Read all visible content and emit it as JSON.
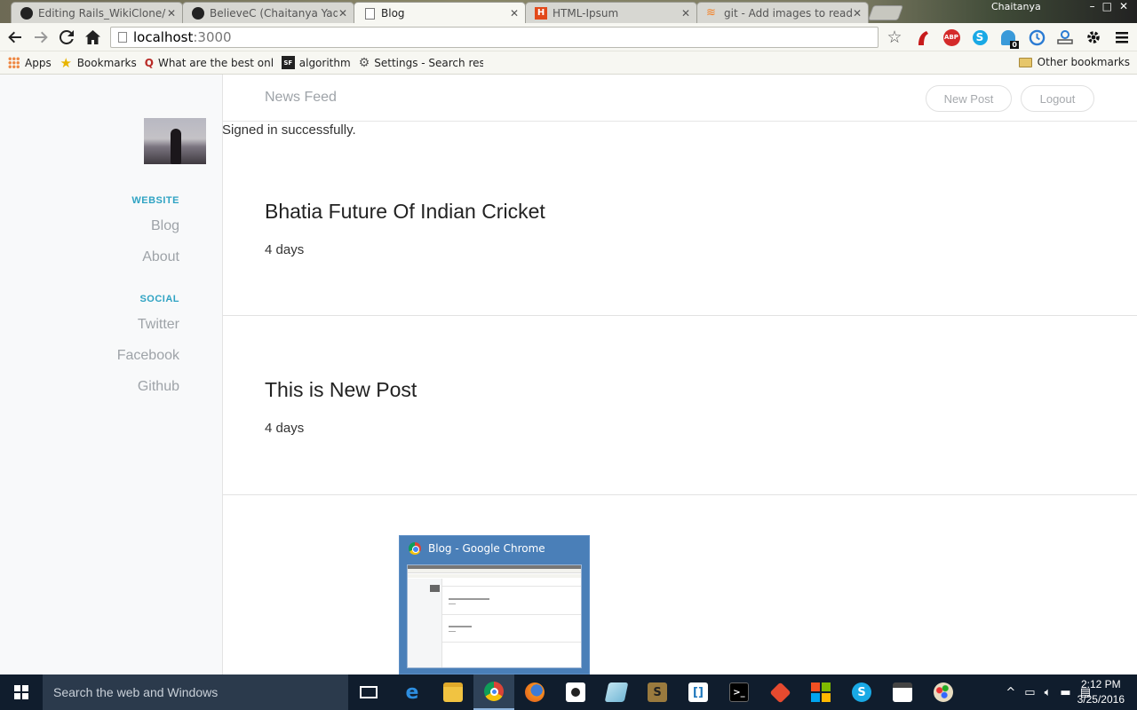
{
  "browser": {
    "tabs": [
      {
        "title": "Editing Rails_WikiClone/R",
        "icon": "github-icon",
        "active": false
      },
      {
        "title": "BelieveC (Chaitanya Yadav",
        "icon": "github-icon",
        "active": false
      },
      {
        "title": "Blog",
        "icon": "page-icon",
        "active": true
      },
      {
        "title": "HTML-Ipsum",
        "icon": "html-ipsum-icon",
        "active": false
      },
      {
        "title": "git - Add images to readm",
        "icon": "stackoverflow-icon",
        "active": false
      }
    ],
    "tab_close": "✕",
    "profile_name": "Chaitanya",
    "url_host": "localhost",
    "url_port": ":3000",
    "extensions": [
      "star-icon",
      "lastpass-icon",
      "adblock-icon",
      "skype-icon",
      "ghostery-icon",
      "history-icon",
      "downloads-icon",
      "settings-gear-icon",
      "menu-icon"
    ],
    "adblock_label": "ABP",
    "ghostery_badge": "0",
    "bookmarks": [
      {
        "label": "Apps",
        "icon": "apps-grid-icon"
      },
      {
        "label": "Bookmarks",
        "icon": "star-bookmark-icon"
      },
      {
        "label": "What are the best onl",
        "icon": "quora-icon"
      },
      {
        "label": "algorithm",
        "icon": "sf-icon"
      },
      {
        "label": "Settings - Search resu",
        "icon": "gear-icon"
      }
    ],
    "other_bookmarks": "Other bookmarks"
  },
  "page": {
    "sidebar": {
      "website_heading": "WEBSITE",
      "website_links": [
        "Blog",
        "About"
      ],
      "social_heading": "SOCIAL",
      "social_links": [
        "Twitter",
        "Facebook",
        "Github"
      ]
    },
    "nav": {
      "brand": "News Feed",
      "new_post": "New Post",
      "logout": "Logout"
    },
    "flash": "Signed in successfully.",
    "posts": [
      {
        "title": "Bhatia Future Of Indian Cricket",
        "time": "4 days"
      },
      {
        "title": "This is New Post",
        "time": "4 days"
      }
    ]
  },
  "preview": {
    "title": "Blog - Google Chrome"
  },
  "taskbar": {
    "search_placeholder": "Search the web and Windows",
    "apps": [
      "task-view-icon",
      "edge-icon",
      "file-explorer-icon",
      "chrome-icon",
      "firefox-icon",
      "camera-icon",
      "notepad-icon",
      "sublime-icon",
      "brackets-icon",
      "terminal-icon",
      "git-icon",
      "windows-store-icon",
      "skype-icon",
      "movie-maker-icon",
      "paint-icon"
    ],
    "time": "2:12 PM",
    "date": "3/25/2016"
  }
}
